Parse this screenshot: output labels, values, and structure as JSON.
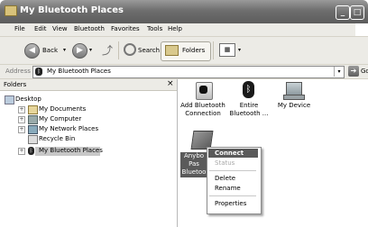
{
  "window": {
    "title": "My Bluetooth Places"
  },
  "menu": {
    "items": [
      "File",
      "Edit",
      "View",
      "Bluetooth",
      "Favorites",
      "Tools",
      "Help"
    ]
  },
  "toolbar": {
    "back_label": "Back",
    "search_label": "Search",
    "folders_label": "Folders"
  },
  "address": {
    "label": "Address",
    "value": "My Bluetooth Places",
    "go_label": "Go"
  },
  "folders_pane": {
    "title": "Folders",
    "close_glyph": "×",
    "tree": [
      "Desktop",
      "My Documents",
      "My Computer",
      "My Network Places",
      "Recycle Bin",
      "My Bluetooth Places"
    ]
  },
  "items": [
    {
      "label_line1": "Add Bluetooth",
      "label_line2": "Connection",
      "icon": "add-bluetooth-icon"
    },
    {
      "label_line1": "Entire",
      "label_line2": "Bluetooth ...",
      "icon": "bluetooth-icon"
    },
    {
      "label_line1": "My Device",
      "label_line2": "",
      "icon": "computer-icon"
    },
    {
      "label_line1": "Anybo",
      "label_line2": "Pas",
      "label_line3": "Bluetoo",
      "icon": "service-icon"
    }
  ],
  "context_menu": {
    "connect": "Connect",
    "status": "Status",
    "delete": "Delete",
    "rename": "Rename",
    "properties": "Properties"
  },
  "colors": {
    "selection": "#5a5a5a",
    "titlebar": "#6e6e6e"
  }
}
